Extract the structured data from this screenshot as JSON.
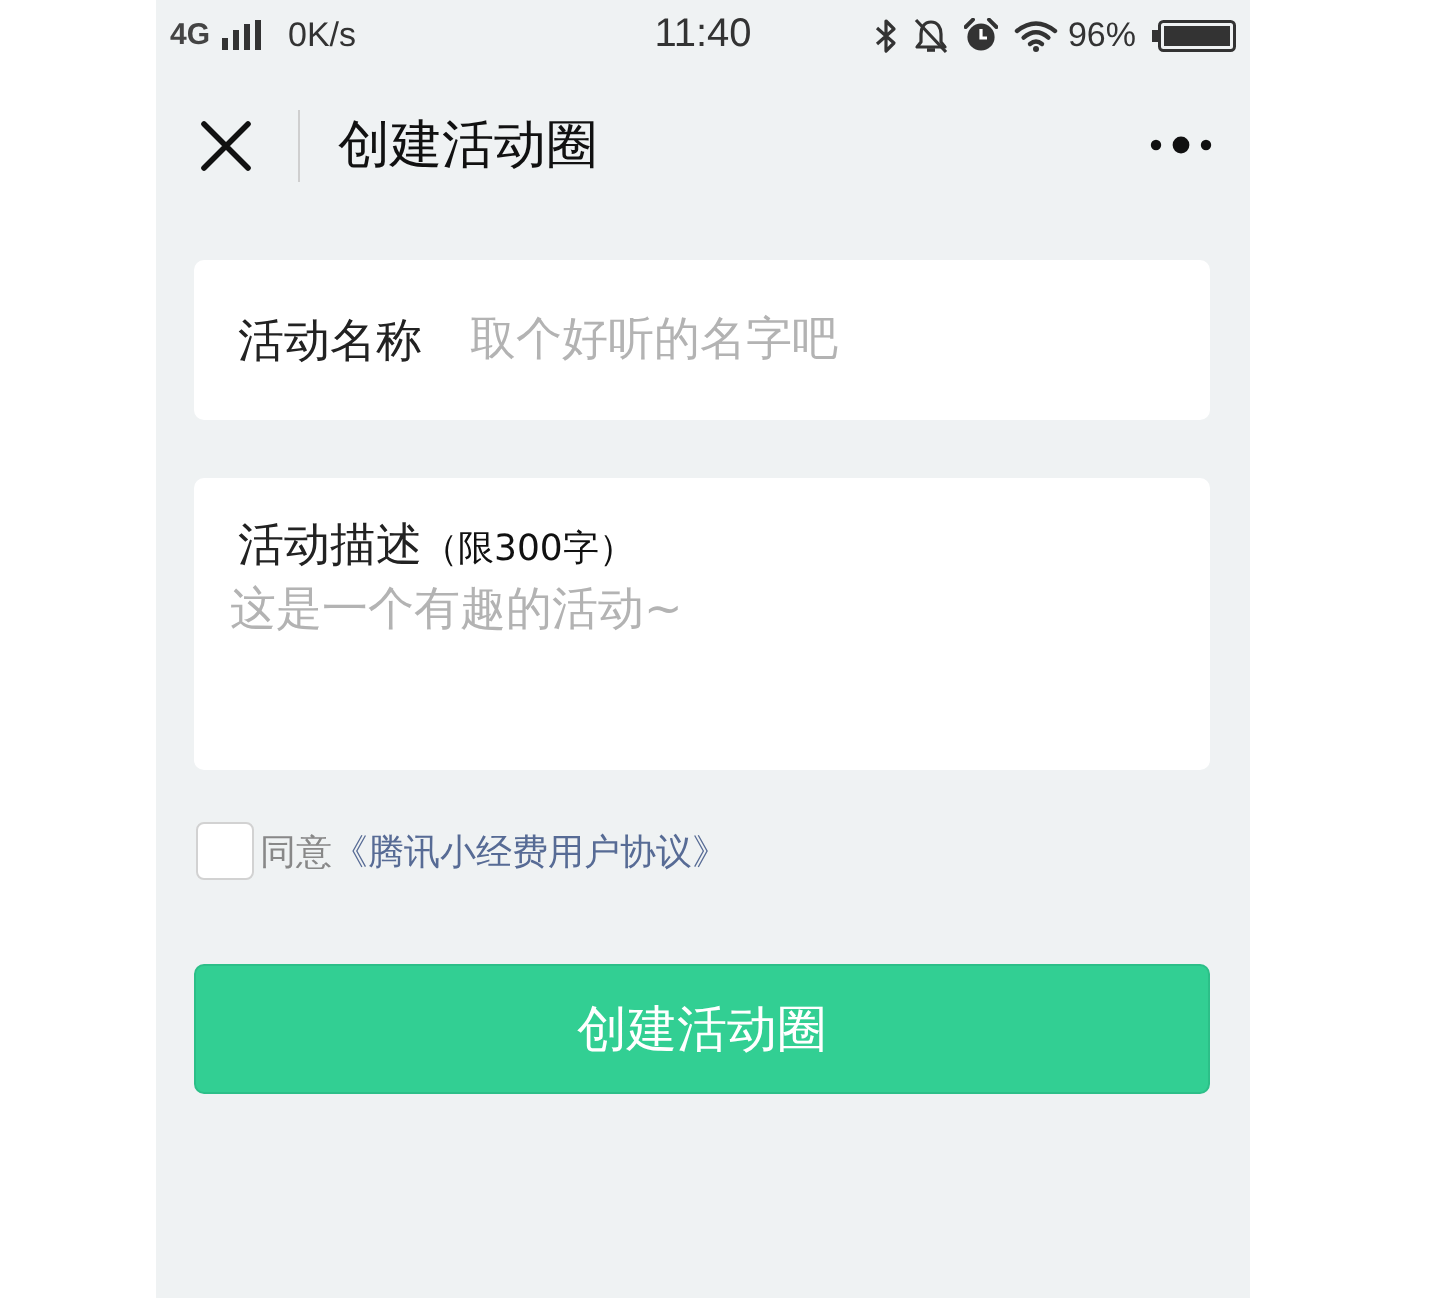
{
  "status_bar": {
    "network": "4G",
    "speed": "0K/s",
    "time": "11:40",
    "battery": "96%"
  },
  "nav_bar": {
    "title": "创建活动圈"
  },
  "form": {
    "fields": [
      {
        "kind": "input",
        "label": "活动名称",
        "placeholder": "取个好听的名字吧"
      },
      {
        "kind": "textarea",
        "label": "活动描述",
        "hint": "（限300字）",
        "placeholder": "这是一个有趣的活动~"
      }
    ]
  },
  "agreement": {
    "checked": false,
    "prefix": "同意",
    "link": "《腾讯小经费用户协议》"
  },
  "submit_button": {
    "label": "创建活动圈"
  }
}
